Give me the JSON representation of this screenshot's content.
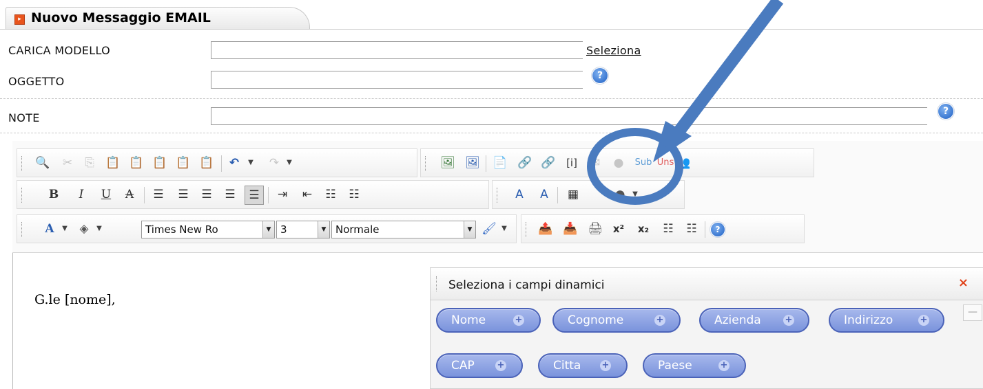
{
  "window": {
    "title": "Nuovo Messaggio EMAIL"
  },
  "form": {
    "carica_modello_label": "CARICA MODELLO",
    "carica_modello_value": "",
    "seleziona_link": "Seleziona",
    "oggetto_label": "OGGETTO",
    "oggetto_value": "",
    "note_label": "NOTE",
    "note_value": "",
    "help_glyph": "?"
  },
  "toolbar": {
    "row1_text_buttons": {
      "sub": "Sub",
      "uns": "Uns"
    },
    "font_family": "Times New Ro",
    "font_size": "3",
    "paragraph_format": "Normale",
    "row2_text_buttons": {
      "bold": "B",
      "italic": "I",
      "underline": "U",
      "strike": "A"
    },
    "row3_text_buttons": {
      "font_color": "A",
      "superscript": "x²",
      "subscript": "x₂"
    }
  },
  "editor": {
    "body_text": "G.le [nome],"
  },
  "dynamic_fields_panel": {
    "title": "Seleziona i campi dinamici",
    "close_glyph": "×",
    "minimize_glyph": "—",
    "fields": [
      {
        "label": "Nome"
      },
      {
        "label": "Cognome"
      },
      {
        "label": "Azienda"
      },
      {
        "label": "Indirizzo"
      },
      {
        "label": "CAP"
      },
      {
        "label": "Citta"
      },
      {
        "label": "Paese"
      }
    ],
    "plus_glyph": "+"
  },
  "annotation": {
    "color": "#4a7bbf"
  },
  "colors": {
    "pill_fill": "#8fa3e3",
    "pill_border": "#4a62b8",
    "close_red": "#e0431b",
    "tab_icon": "#e8541c"
  }
}
